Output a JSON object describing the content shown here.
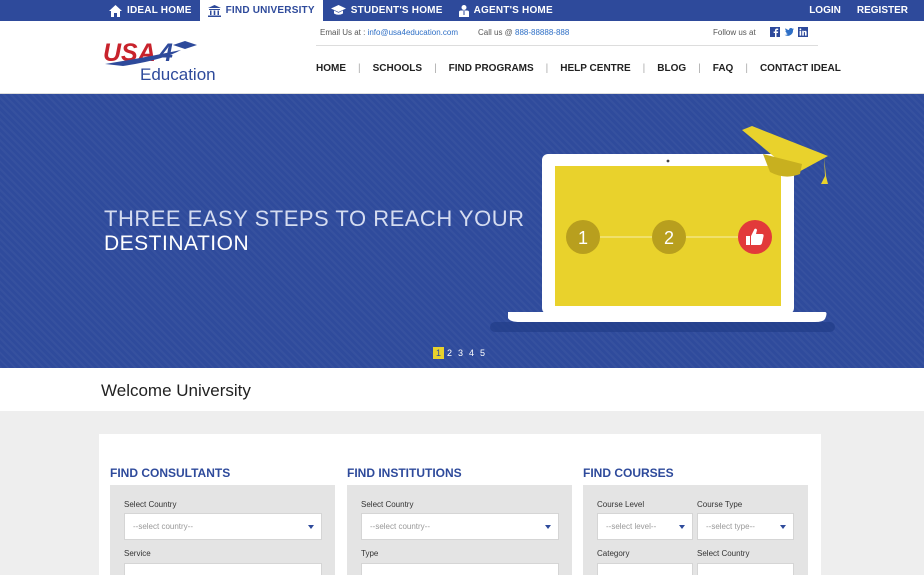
{
  "topnav": [
    {
      "label": "IDEAL HOME",
      "icon": "home-icon"
    },
    {
      "label": "FIND UNIVERSITY",
      "icon": "university-icon"
    },
    {
      "label": "STUDENT'S HOME",
      "icon": "graduation-cap-icon"
    },
    {
      "label": "AGENT'S HOME",
      "icon": "agent-icon"
    }
  ],
  "topright": {
    "login": "LOGIN",
    "register": "REGISTER"
  },
  "logo": {
    "word1": "USA",
    "numeral": "4",
    "word2": "Education"
  },
  "contact": {
    "email_label": "Email Us at : ",
    "email": "info@usa4education.com",
    "call_label": "Call us @ ",
    "phone": "888-88888-888",
    "follow": "Follow us at"
  },
  "mainnav": [
    "HOME",
    "SCHOOLS",
    "FIND PROGRAMS",
    "HELP CENTRE",
    "BLOG",
    "FAQ",
    "CONTACT IDEAL"
  ],
  "hero": {
    "line1": "THREE EASY STEPS TO REACH YOUR",
    "line2": "DESTINATION",
    "step1": "1",
    "step2": "2",
    "pages": [
      "1",
      "2",
      "3",
      "4",
      "5"
    ],
    "active_page": 1
  },
  "welcome": "Welcome University",
  "search": {
    "consultants": {
      "title": "FIND CONSULTANTS",
      "country_label": "Select Country",
      "country_value": "--select country--",
      "service_label": "Service"
    },
    "institutions": {
      "title": "FIND INSTITUTIONS",
      "country_label": "Select Country",
      "country_value": "--select country--",
      "type_label": "Type"
    },
    "courses": {
      "title": "FIND COURSES",
      "level_label": "Course Level",
      "level_value": "--select level--",
      "type_label": "Course Type",
      "type_value": "--select type--",
      "category_label": "Category",
      "country_label": "Select Country"
    }
  },
  "colors": {
    "brand_blue": "#2e4a9b",
    "accent_yellow": "#e8d22b",
    "logo_red": "#c8232c"
  }
}
